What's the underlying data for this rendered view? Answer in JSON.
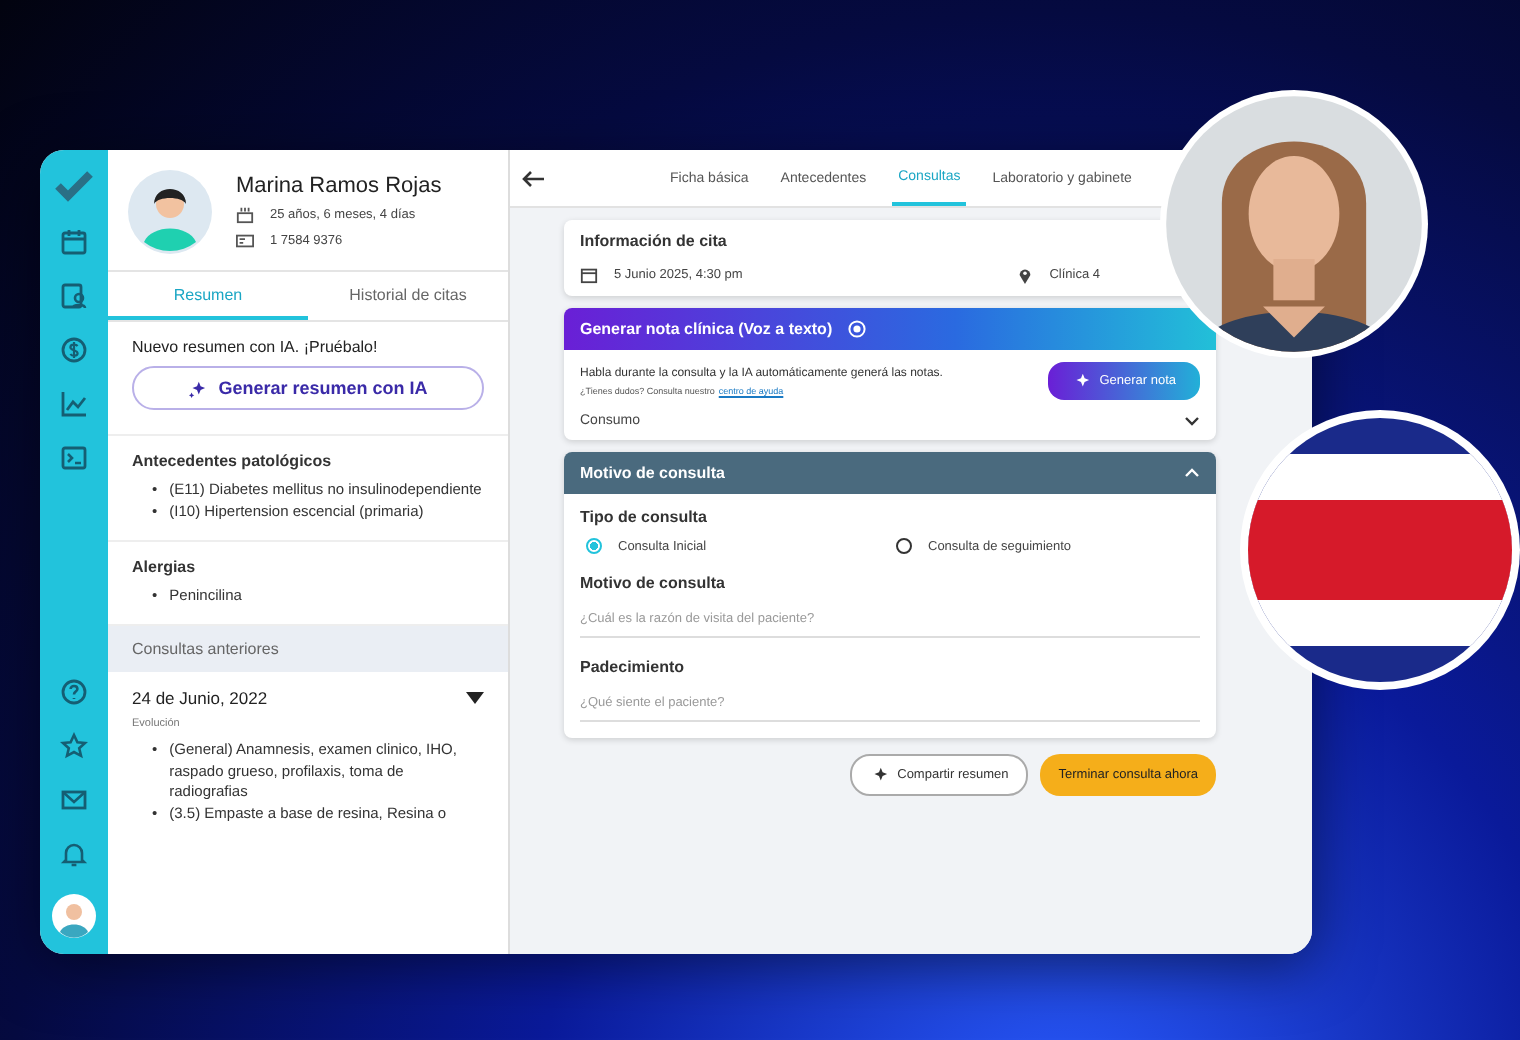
{
  "list_marker": "•",
  "patient": {
    "name": "Marina Ramos Rojas",
    "age": "25 años, 6 meses, 4 días",
    "id": "1 7584 9376"
  },
  "left_tabs": [
    {
      "label": "Resumen",
      "selected": true
    },
    {
      "label": "Historial de citas",
      "selected": false
    }
  ],
  "ai_summary": {
    "prompt": "Nuevo resumen con IA. ¡Pruébalo!",
    "button": "Generar resumen con IA"
  },
  "sections": [
    {
      "title": "Antecedentes patológicos",
      "items": [
        "(E11) Diabetes mellitus no insulinodependiente",
        "(I10) Hipertension escencial (primaria)"
      ]
    },
    {
      "title": "Alergias",
      "items": [
        "Penincilina"
      ]
    }
  ],
  "previous": {
    "header": "Consultas anteriores",
    "date": "24 de Junio, 2022",
    "label": "Evolución",
    "items": [
      "(General) Anamnesis, examen clinico, IHO, raspado grueso, profilaxis, toma de radiografias",
      "(3.5) Empaste a base de resina, Resina o"
    ]
  },
  "tabs": [
    {
      "label": "Ficha básica",
      "selected": false
    },
    {
      "label": "Antecedentes",
      "selected": false
    },
    {
      "label": "Consultas",
      "selected": true
    },
    {
      "label": "Laboratorio y gabinete",
      "selected": false
    }
  ],
  "appointment": {
    "title": "Información de cita",
    "date": "5 Junio 2025, 4:30 pm",
    "place": "Clínica 4"
  },
  "note": {
    "title": "Generar nota clínica (Voz a texto)",
    "text": "Habla durante la consulta y la IA automáticamente generá las notas.",
    "help_prefix": "¿Tienes dudos? Consulta nuestro",
    "help_link": "centro de ayuda",
    "button": "Generar nota",
    "dropdown": "Consumo"
  },
  "motivo": {
    "title": "Motivo de consulta",
    "expanded": true,
    "type_label": "Tipo de consulta",
    "options": [
      {
        "label": "Consulta Inicial",
        "selected": true
      },
      {
        "label": "Consulta de seguimiento",
        "selected": false
      }
    ],
    "fields": [
      {
        "label": "Motivo de consulta",
        "placeholder": "¿Cuál es la razón de visita del paciente?"
      },
      {
        "label": "Padecimiento",
        "placeholder": "¿Qué siente el paciente?"
      }
    ]
  },
  "actions": [
    {
      "label": "Compartir resumen",
      "kind": "outline"
    },
    {
      "label": "Terminar consulta ahora",
      "kind": "primary"
    }
  ]
}
